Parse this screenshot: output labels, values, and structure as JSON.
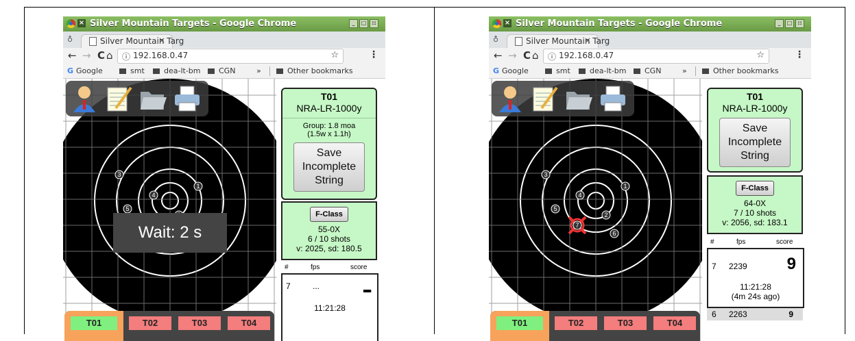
{
  "browser": {
    "window_title": "Silver Mountain Targets - Google Chrome",
    "close_glyph": "×",
    "tab_title": "Silver Mountain Targ",
    "tab_close": "×",
    "back": "←",
    "forward": "→",
    "reload": "C",
    "home": "⌂",
    "info_glyph": "ⓘ",
    "url": "192.168.0.47",
    "star": "☆",
    "menu": "⋮",
    "bookmarks": [
      "Google",
      "smt",
      "dea-lt-bm",
      "CGN"
    ],
    "more_bookmarks": "»",
    "other_bookmarks": "Other bookmarks"
  },
  "target_tabs": [
    "T01",
    "T02",
    "T03",
    "T04"
  ],
  "colors": {
    "active_tab": "#7ff07f",
    "inactive_tab": "#f47d7d",
    "active_tab_frame": "#f7a35c",
    "panel_green": "#c6f7c6"
  },
  "left": {
    "target_id": "T01",
    "target_name": "NRA-LR-1000y",
    "group_line1": "Group: 1.8 moa",
    "group_line2": "(1.5w x 1.1h)",
    "save_button": [
      "Save",
      "Incomplete",
      "String"
    ],
    "fclass_button": "F-Class",
    "score": "55-0X",
    "shots": "6 / 10 shots",
    "velocity": "v: 2025, sd: 180.5",
    "col_num": "#",
    "col_fps": "fps",
    "col_score": "score",
    "last_shot_num": "7",
    "last_shot_fps": "...",
    "last_shot_score": "▪▪▪",
    "last_shot_time": "11:21:28",
    "overlay": "Wait: 2 s",
    "shot_labels": [
      "1",
      "2",
      "3",
      "4",
      "5"
    ]
  },
  "right": {
    "target_id": "T01",
    "target_name": "NRA-LR-1000y",
    "save_button": [
      "Save",
      "Incomplete",
      "String"
    ],
    "fclass_button": "F-Class",
    "score": "64-0X",
    "shots": "7 / 10 shots",
    "velocity": "v: 2056, sd: 183.1",
    "col_num": "#",
    "col_fps": "fps",
    "col_score": "score",
    "last_shot_num": "7",
    "last_shot_fps": "2239",
    "last_shot_score": "9",
    "last_shot_time": "11:21:28",
    "last_shot_ago": "(4m 24s ago)",
    "prev_shot_num": "6",
    "prev_shot_fps": "2263",
    "prev_shot_score": "9",
    "shot_labels": [
      "1",
      "2",
      "3",
      "4",
      "5",
      "6",
      "7"
    ]
  }
}
